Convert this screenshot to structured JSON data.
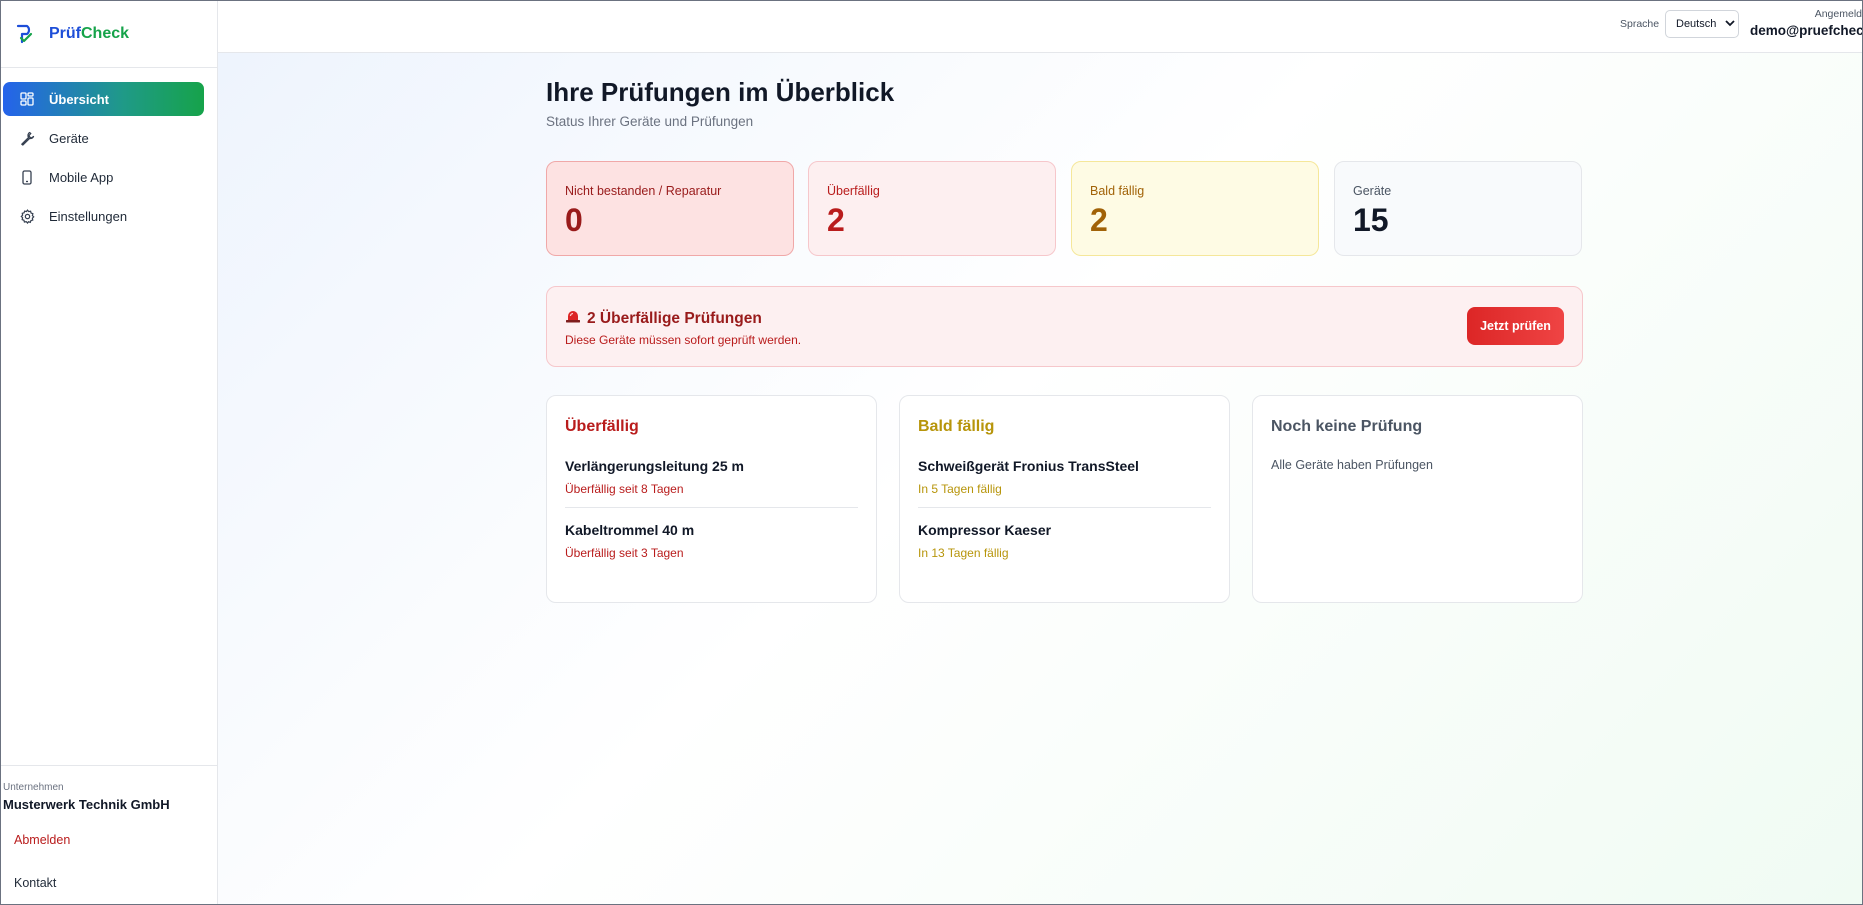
{
  "brand": {
    "name_part1": "Prüf",
    "name_part2": "Check",
    "logo_icon": "shield-check-icon"
  },
  "sidebar": {
    "items": [
      {
        "label": "Übersicht",
        "icon": "dashboard-grid-icon",
        "active": true
      },
      {
        "label": "Geräte",
        "icon": "wrench-icon",
        "active": false
      },
      {
        "label": "Mobile App",
        "icon": "smartphone-icon",
        "active": false
      },
      {
        "label": "Einstellungen",
        "icon": "gear-icon",
        "active": false
      }
    ],
    "company_label": "Unternehmen",
    "company_name": "Musterwerk Technik GmbH",
    "logout_label": "Abmelden",
    "contact_label": "Kontakt"
  },
  "topbar": {
    "language_label": "Sprache",
    "language_value": "Deutsch",
    "user_label": "Angemeld",
    "user_email": "demo@pruefcheck."
  },
  "page": {
    "title": "Ihre Prüfungen im Überblick",
    "subtitle": "Status Ihrer Geräte und Prüfungen"
  },
  "stats": [
    {
      "label": "Nicht bestanden / Reparatur",
      "value": "0"
    },
    {
      "label": "Überfällig",
      "value": "2"
    },
    {
      "label": "Bald fällig",
      "value": "2"
    },
    {
      "label": "Geräte",
      "value": "15"
    }
  ],
  "alert": {
    "icon": "siren-icon",
    "title": "2 Überfällige Prüfungen",
    "description": "Diese Geräte müssen sofort geprüft werden.",
    "button_label": "Jetzt prüfen"
  },
  "cards": {
    "overdue": {
      "title": "Überfällig",
      "entries": [
        {
          "name": "Verlängerungsleitung 25 m",
          "status": "Überfällig seit 8 Tagen"
        },
        {
          "name": "Kabeltrommel 40 m",
          "status": "Überfällig seit 3 Tagen"
        }
      ]
    },
    "soon": {
      "title": "Bald fällig",
      "entries": [
        {
          "name": "Schweißgerät Fronius TransSteel",
          "status": "In 5 Tagen fällig"
        },
        {
          "name": "Kompressor Kaeser",
          "status": "In 13 Tagen fällig"
        }
      ]
    },
    "none": {
      "title": "Noch keine Prüfung",
      "text": "Alle Geräte haben Prüfungen"
    }
  },
  "colors": {
    "brand_blue": "#1d4ed8",
    "brand_green": "#16a34a",
    "danger": "#b91c1c",
    "warning": "#b7950b"
  }
}
